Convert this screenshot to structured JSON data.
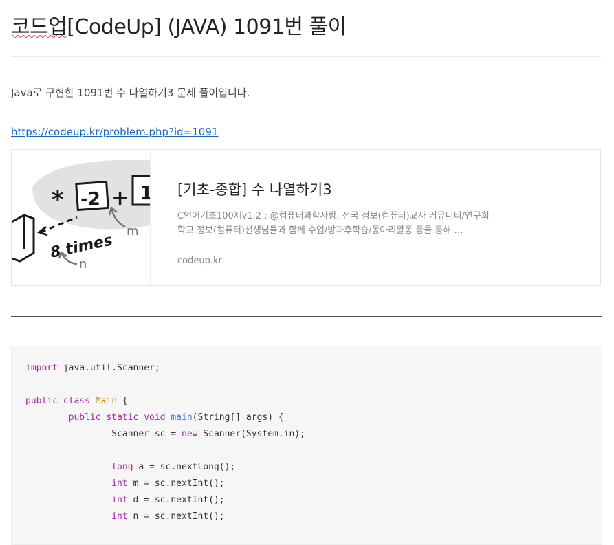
{
  "post": {
    "title": "코드업[CodeUp] (JAVA) 1091번 풀이",
    "intro": "Java로 구현한 1091번 수 나열하기3 문제 풀이입니다.",
    "link": "https://codeup.kr/problem.php?id=1091"
  },
  "og_card": {
    "title": "[기초-종합] 수 나열하기3",
    "description": "C언어기초100제v1.2 : @컴퓨터과학사랑, 전국 정보(컴퓨터)교사 커뮤니티/연구회 - 학교 정보(컴퓨터)선생님들과 함께 수업/방과후학습/동아리활동 등을 통해 …",
    "domain": "codeup.kr",
    "thumbnail": {
      "symbols": [
        "*",
        "-2",
        "+",
        "1"
      ],
      "text": "8 times",
      "labels": [
        "m",
        "n"
      ]
    }
  },
  "code": {
    "language": "java",
    "lines": [
      [
        {
          "t": "import",
          "c": "kw"
        },
        {
          "t": " java.util.Scanner;"
        }
      ],
      [],
      [
        {
          "t": "public",
          "c": "kw"
        },
        {
          "t": " "
        },
        {
          "t": "class",
          "c": "kw"
        },
        {
          "t": " "
        },
        {
          "t": "Main",
          "c": "ty"
        },
        {
          "t": " {"
        }
      ],
      [
        {
          "t": "        "
        },
        {
          "t": "public",
          "c": "kw"
        },
        {
          "t": " "
        },
        {
          "t": "static",
          "c": "kw"
        },
        {
          "t": " "
        },
        {
          "t": "void",
          "c": "kw"
        },
        {
          "t": " "
        },
        {
          "t": "main",
          "c": "fn"
        },
        {
          "t": "(String[] args) {"
        }
      ],
      [
        {
          "t": "                Scanner sc = "
        },
        {
          "t": "new",
          "c": "kw"
        },
        {
          "t": " Scanner(System.in);"
        }
      ],
      [],
      [
        {
          "t": "                "
        },
        {
          "t": "long",
          "c": "kw"
        },
        {
          "t": " a = sc.nextLong();"
        }
      ],
      [
        {
          "t": "                "
        },
        {
          "t": "int",
          "c": "kw"
        },
        {
          "t": " m = sc.nextInt();"
        }
      ],
      [
        {
          "t": "                "
        },
        {
          "t": "int",
          "c": "kw"
        },
        {
          "t": " d = sc.nextInt();"
        }
      ],
      [
        {
          "t": "                "
        },
        {
          "t": "int",
          "c": "kw"
        },
        {
          "t": " n = sc.nextInt();"
        }
      ]
    ]
  },
  "colors": {
    "link": "#1a66c2",
    "keyword": "#a626a4",
    "type": "#c18401",
    "function": "#4078f2",
    "code_bg": "#f6f6f6"
  }
}
